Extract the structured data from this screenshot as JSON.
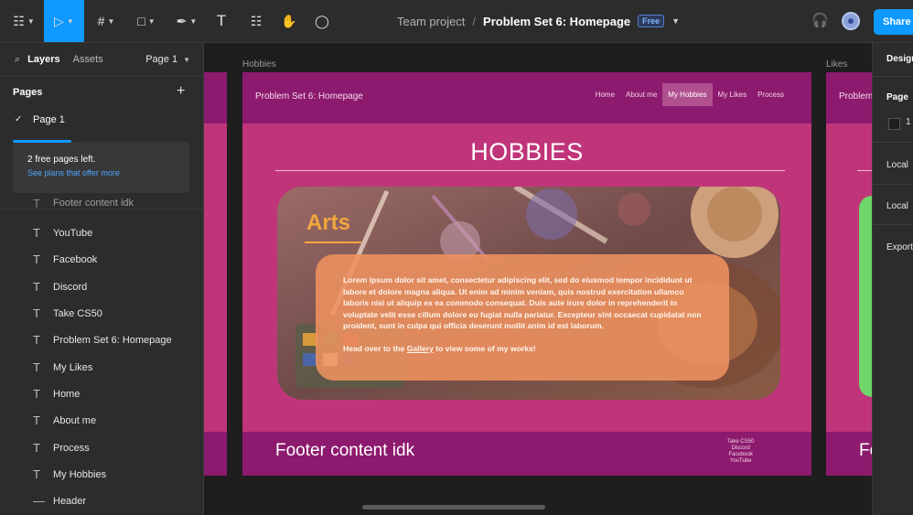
{
  "toolbar": {
    "tools": [
      {
        "icon": "main-menu-icon",
        "glyph": "☷",
        "caret": true
      },
      {
        "icon": "move-tool-icon",
        "glyph": "▷",
        "caret": true,
        "active": true
      },
      {
        "icon": "frame-tool-icon",
        "glyph": "#",
        "caret": true
      },
      {
        "icon": "shape-tool-icon",
        "glyph": "□",
        "caret": true
      },
      {
        "icon": "pen-tool-icon",
        "glyph": "✒",
        "caret": true
      },
      {
        "icon": "text-tool-icon",
        "glyph": "T"
      },
      {
        "icon": "resources-icon",
        "glyph": "☷"
      },
      {
        "icon": "hand-tool-icon",
        "glyph": "✋"
      },
      {
        "icon": "comment-tool-icon",
        "glyph": "◯"
      }
    ],
    "team": "Team project",
    "separator": "/",
    "file": "Problem Set 6: Homepage",
    "badge": "Free",
    "share": "Share"
  },
  "left_panel": {
    "tab_layers": "Layers",
    "tab_assets": "Assets",
    "page_select": "Page 1",
    "pages_title": "Pages",
    "add": "+",
    "current_page": "Page 1",
    "notice_title": "2 free pages left.",
    "notice_link": "See plans that offer more",
    "partial_layer": "Footer content idk",
    "layers": [
      "YouTube",
      "Facebook",
      "Discord",
      "Take CS50",
      "Problem Set 6: Homepage",
      "My Likes",
      "Home",
      "About me",
      "Process",
      "My Hobbies",
      "Header"
    ]
  },
  "canvas": {
    "frame_label": "Hobbies",
    "frame_label_right": "Likes"
  },
  "site": {
    "nav_title": "Problem Set 6: Homepage",
    "nav_links": [
      "Home",
      "About me",
      "My Hobbies",
      "My Likes",
      "Process"
    ],
    "nav_current": 2,
    "title": "HOBBIES",
    "hero_heading": "Arts",
    "paragraph": "Lorem ipsum dolor sit amet, consectetur adipiscing elit, sed do eiusmod tempor incididunt ut labore et dolore magna aliqua. Ut enim ad minim veniam, quis nostrud exercitation ullamco laboris nisi ut aliquip ex ea commodo consequat. Duis aute irure dolor in reprehenderit in voluptate velit esse cillum dolore eu fugiat nulla pariatur. Excepteur sint occaecat cupidatat non proident, sunt in culpa qui officia deserunt mollit anim id est laborum.",
    "cta_before": "Head over to the",
    "cta_link": "Gallery",
    "cta_after": "to view some of my works!",
    "footer_text": "Footer content idk",
    "footer_links": [
      "Take CS50",
      "Discord",
      "Facebook",
      "YouTube"
    ],
    "right_frame_nav": "Problem",
    "right_frame_footer": "Fo"
  },
  "right_panel": {
    "design": "Design",
    "page": "Page",
    "value": "1",
    "local1": "Local",
    "local2": "Local",
    "export": "Export"
  },
  "colors": {
    "accent": "#0d99ff",
    "site_bg": "#c0357a",
    "site_nav": "#8c1a6e",
    "arts": "#f2a63e"
  }
}
